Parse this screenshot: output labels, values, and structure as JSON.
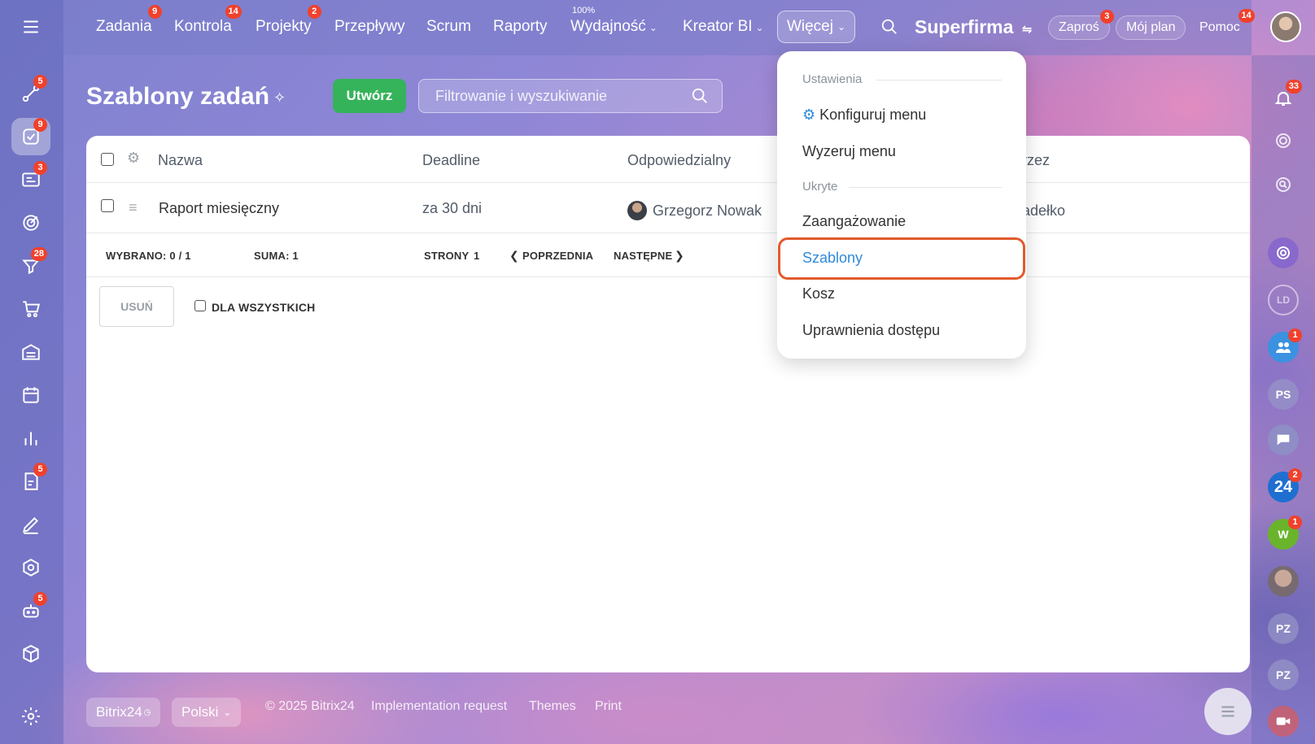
{
  "topnav": {
    "items": [
      {
        "label": "Zadania",
        "badge": "9"
      },
      {
        "label": "Kontrola",
        "badge": "14"
      },
      {
        "label": "Projekty",
        "badge": "2"
      },
      {
        "label": "Przepływy"
      },
      {
        "label": "Scrum"
      },
      {
        "label": "Raporty"
      },
      {
        "label": "Wydajność",
        "super": "100%"
      },
      {
        "label": "Kreator BI"
      }
    ],
    "more_label": "Więcej",
    "company": "Superfirma",
    "invite_label": "Zaproś",
    "invite_badge": "3",
    "myplan_label": "Mój plan",
    "help_label": "Pomoc",
    "help_badge": "14"
  },
  "left_rail": {
    "badges": {
      "flows": "5",
      "tasks": "9",
      "crm": "3",
      "feed": "28",
      "docs": "5",
      "bot": "5"
    }
  },
  "right_rail": {
    "notifications_badge": "33",
    "group_badge": "1",
    "b24_badge": "2",
    "w_badge": "1",
    "ps_label": "PS",
    "ld_label": "LD",
    "pz1_label": "PZ",
    "pz2_label": "PZ",
    "b24_label": "24",
    "w_label": "W"
  },
  "page": {
    "title": "Szablony zadań",
    "create_label": "Utwórz",
    "search_placeholder": "Filtrowanie i wyszukiwanie"
  },
  "grid": {
    "columns": {
      "name": "Nazwa",
      "deadline": "Deadline",
      "responsible": "Odpowiedzialny",
      "created_by_partial": "rzez"
    },
    "rows": [
      {
        "name": "Raport miesięczny",
        "deadline": "za 30 dni",
        "responsible": "Grzegorz Nowak",
        "created_by_partial": "adełko"
      }
    ],
    "footer": {
      "selected": "WYBRANO: 0 / 1",
      "total": "SUMA: 1",
      "pages_label": "STRONY",
      "pages_value": "1",
      "prev": "POPRZEDNIA",
      "next": "NASTĘPNE"
    },
    "delete_label": "USUŃ",
    "for_all_label": "DLA WSZYSTKICH"
  },
  "dropdown": {
    "section_settings": "Ustawienia",
    "configure": "Konfiguruj menu",
    "reset": "Wyzeruj menu",
    "section_hidden": "Ukryte",
    "engagement": "Zaangażowanie",
    "templates": "Szablony",
    "trash": "Kosz",
    "permissions": "Uprawnienia dostępu"
  },
  "footer": {
    "brand": "Bitrix24",
    "language": "Polski",
    "copyright": "© 2025 Bitrix24",
    "impl": "Implementation request",
    "themes": "Themes",
    "print": "Print"
  },
  "colors": {
    "accent": "#2f8ad8",
    "create": "#35b35a",
    "highlight": "#e25a2c",
    "badge": "#f0412c"
  }
}
